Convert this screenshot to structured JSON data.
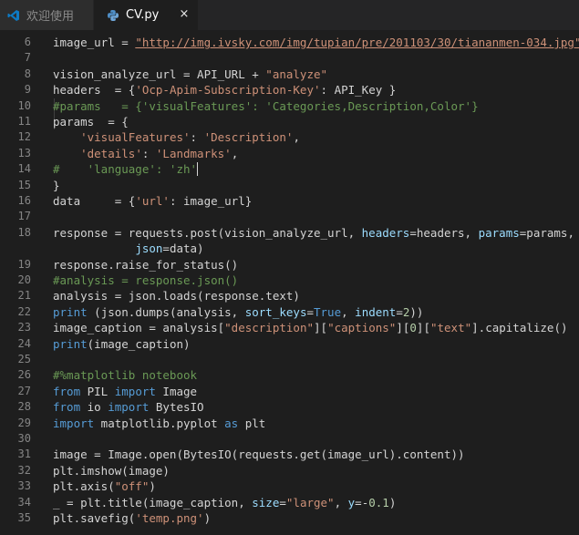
{
  "tabs": [
    {
      "label": "欢迎使用",
      "icon": "vscode-logo-icon",
      "active": false
    },
    {
      "label": "CV.py",
      "icon": "python-file-icon",
      "active": true,
      "close": "×"
    }
  ],
  "colors": {
    "background": "#1e1e1e",
    "tabbar": "#252526",
    "string": "#ce9178",
    "comment": "#6a9955",
    "keyword": "#569cd6",
    "parameter": "#9cdcfe",
    "number": "#b5cea8",
    "text": "#d4d4d4",
    "line_number": "#858585"
  },
  "editor": {
    "cursor_line": "14",
    "lines": [
      {
        "ln": "6",
        "tokens": [
          [
            "txt",
            "image_url = "
          ],
          [
            "url",
            "\"http://img.ivsky.com/img/tupian/pre/201103/30/tiananmen-034.jpg\""
          ]
        ]
      },
      {
        "ln": "7",
        "tokens": []
      },
      {
        "ln": "8",
        "tokens": [
          [
            "txt",
            "vision_analyze_url = API_URL + "
          ],
          [
            "str",
            "\"analyze\""
          ]
        ]
      },
      {
        "ln": "9",
        "tokens": [
          [
            "txt",
            "headers  = {"
          ],
          [
            "str",
            "'Ocp-Apim-Subscription-Key'"
          ],
          [
            "txt",
            ": API_Key }"
          ]
        ]
      },
      {
        "ln": "10",
        "tokens": [
          [
            "cmt",
            "#params   = {'visualFeatures': 'Categories,Description,Color'}"
          ]
        ]
      },
      {
        "ln": "11",
        "tokens": [
          [
            "txt",
            "params  = {"
          ]
        ]
      },
      {
        "ln": "12",
        "tokens": [
          [
            "txt",
            "    "
          ],
          [
            "str",
            "'visualFeatures'"
          ],
          [
            "txt",
            ": "
          ],
          [
            "str",
            "'Description'"
          ],
          [
            "txt",
            ","
          ]
        ]
      },
      {
        "ln": "13",
        "tokens": [
          [
            "txt",
            "    "
          ],
          [
            "str",
            "'details'"
          ],
          [
            "txt",
            ": "
          ],
          [
            "str",
            "'Landmarks'"
          ],
          [
            "txt",
            ","
          ]
        ]
      },
      {
        "ln": "14",
        "tokens": [
          [
            "cmt",
            "#    'language': 'zh'"
          ]
        ]
      },
      {
        "ln": "15",
        "tokens": [
          [
            "txt",
            "}"
          ]
        ]
      },
      {
        "ln": "16",
        "tokens": [
          [
            "txt",
            "data     = {"
          ],
          [
            "str",
            "'url'"
          ],
          [
            "txt",
            ": image_url}"
          ]
        ]
      },
      {
        "ln": "17",
        "tokens": []
      },
      {
        "ln": "18",
        "tokens": [
          [
            "txt",
            "response = requests.post(vision_analyze_url, "
          ],
          [
            "par",
            "headers"
          ],
          [
            "txt",
            "=headers, "
          ],
          [
            "par",
            "params"
          ],
          [
            "txt",
            "=params,"
          ]
        ]
      },
      {
        "ln": "",
        "tokens": [
          [
            "txt",
            "            "
          ],
          [
            "par",
            "json"
          ],
          [
            "txt",
            "=data)"
          ]
        ]
      },
      {
        "ln": "19",
        "tokens": [
          [
            "txt",
            "response.raise_for_status()"
          ]
        ]
      },
      {
        "ln": "20",
        "tokens": [
          [
            "cmt",
            "#analysis = response.json()"
          ]
        ]
      },
      {
        "ln": "21",
        "tokens": [
          [
            "txt",
            "analysis = json.loads(response.text)"
          ]
        ]
      },
      {
        "ln": "22",
        "tokens": [
          [
            "kw",
            "print"
          ],
          [
            "txt",
            " (json.dumps(analysis, "
          ],
          [
            "par",
            "sort_keys"
          ],
          [
            "txt",
            "="
          ],
          [
            "kw",
            "True"
          ],
          [
            "txt",
            ", "
          ],
          [
            "par",
            "indent"
          ],
          [
            "txt",
            "="
          ],
          [
            "num",
            "2"
          ],
          [
            "txt",
            "))"
          ]
        ]
      },
      {
        "ln": "23",
        "tokens": [
          [
            "txt",
            "image_caption = analysis["
          ],
          [
            "str",
            "\"description\""
          ],
          [
            "txt",
            "]["
          ],
          [
            "str",
            "\"captions\""
          ],
          [
            "txt",
            "]["
          ],
          [
            "num",
            "0"
          ],
          [
            "txt",
            "]["
          ],
          [
            "str",
            "\"text\""
          ],
          [
            "txt",
            "].capitalize()"
          ]
        ]
      },
      {
        "ln": "24",
        "tokens": [
          [
            "kw",
            "print"
          ],
          [
            "txt",
            "(image_caption)"
          ]
        ]
      },
      {
        "ln": "25",
        "tokens": []
      },
      {
        "ln": "26",
        "tokens": [
          [
            "cmt",
            "#%matplotlib notebook"
          ]
        ]
      },
      {
        "ln": "27",
        "tokens": [
          [
            "kw",
            "from"
          ],
          [
            "txt",
            " PIL "
          ],
          [
            "kw",
            "import"
          ],
          [
            "txt",
            " Image"
          ]
        ]
      },
      {
        "ln": "28",
        "tokens": [
          [
            "kw",
            "from"
          ],
          [
            "txt",
            " io "
          ],
          [
            "kw",
            "import"
          ],
          [
            "txt",
            " BytesIO"
          ]
        ]
      },
      {
        "ln": "29",
        "tokens": [
          [
            "kw",
            "import"
          ],
          [
            "txt",
            " matplotlib.pyplot "
          ],
          [
            "kw",
            "as"
          ],
          [
            "txt",
            " plt"
          ]
        ]
      },
      {
        "ln": "30",
        "tokens": []
      },
      {
        "ln": "31",
        "tokens": [
          [
            "txt",
            "image = Image.open(BytesIO(requests.get(image_url).content))"
          ]
        ]
      },
      {
        "ln": "32",
        "tokens": [
          [
            "txt",
            "plt.imshow(image)"
          ]
        ]
      },
      {
        "ln": "33",
        "tokens": [
          [
            "txt",
            "plt.axis("
          ],
          [
            "str",
            "\"off\""
          ],
          [
            "txt",
            ")"
          ]
        ]
      },
      {
        "ln": "34",
        "tokens": [
          [
            "txt",
            "_ = plt.title(image_caption, "
          ],
          [
            "par",
            "size"
          ],
          [
            "txt",
            "="
          ],
          [
            "str",
            "\"large\""
          ],
          [
            "txt",
            ", "
          ],
          [
            "par",
            "y"
          ],
          [
            "txt",
            "=-"
          ],
          [
            "num",
            "0.1"
          ],
          [
            "txt",
            ")"
          ]
        ]
      },
      {
        "ln": "35",
        "tokens": [
          [
            "txt",
            "plt.savefig("
          ],
          [
            "str",
            "'temp.png'"
          ],
          [
            "txt",
            ")"
          ]
        ]
      }
    ]
  }
}
